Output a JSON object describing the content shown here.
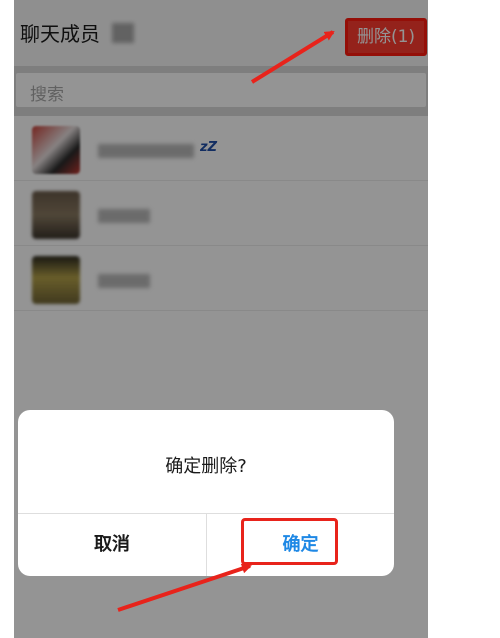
{
  "header": {
    "title": "聊天成员",
    "delete_label": "删除(1)"
  },
  "search": {
    "placeholder": "搜索"
  },
  "members": [
    {
      "status": "zZ"
    },
    {
      "status": ""
    },
    {
      "status": ""
    }
  ],
  "dialog": {
    "message": "确定删除?",
    "cancel_label": "取消",
    "confirm_label": "确定"
  },
  "colors": {
    "delete_bg": "#ff3b30",
    "confirm_text": "#1e88e5",
    "annotation": "#e8231b"
  }
}
